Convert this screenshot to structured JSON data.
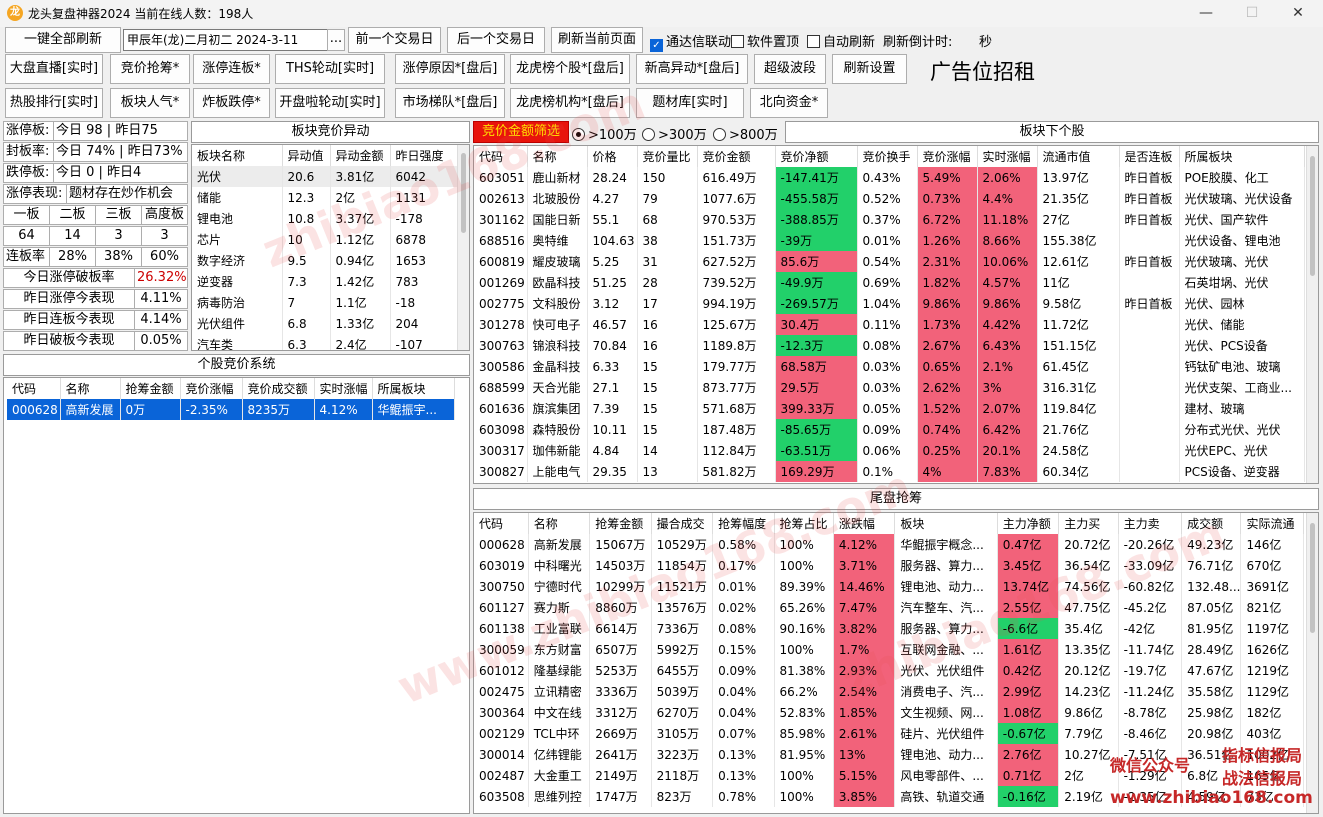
{
  "window": {
    "title": "龙头复盘神器2024 当前在线人数：198人",
    "logo": "龙",
    "min": "—",
    "max": "☐",
    "close": "✕"
  },
  "toolbar1": {
    "refresh_all": "一键全部刷新",
    "date": "甲辰年(龙)二月初二  2024-3-11",
    "date_btn": "...",
    "prev_day": "前一个交易日",
    "next_day": "后一个交易日",
    "refresh_page": "刷新当前页面",
    "tdx_link": "通达信联动",
    "on_top": "软件置顶",
    "auto_refresh": "自动刷新",
    "countdown_label": "刷新倒计时:",
    "countdown_unit": "秒"
  },
  "toolbar2": [
    "大盘直播[实时]",
    "竞价抢筹*",
    "涨停连板*",
    "THS轮动[实时]",
    "涨停原因*[盘后]",
    "龙虎榜个股*[盘后]",
    "新高异动*[盘后]",
    "超级波段",
    "刷新设置"
  ],
  "toolbar3": [
    "热股排行[实时]",
    "板块人气*",
    "炸板跌停*",
    "开盘啦轮动[实时]",
    "市场梯队*[盘后]",
    "龙虎榜机构*[盘后]",
    "题材库[实时]",
    "北向资金*"
  ],
  "ad_text": "广告位招租",
  "stats": {
    "limit_up_label": "涨停板:",
    "limit_up_val": "今日 98 | 昨日75",
    "seal_rate_label": "封板率:",
    "seal_rate_val": "今日 74% | 昨日73%",
    "limit_down_label": "跌停板:",
    "limit_down_val": "今日 0 | 昨日4",
    "perf_label": "涨停表现:",
    "perf_val": "题材存在炒作机会",
    "board_headers": [
      "一板",
      "二板",
      "三板",
      "高度板"
    ],
    "board_values": [
      "64",
      "14",
      "3",
      "3"
    ],
    "lianban_label": "连板率",
    "lianban_values": [
      "28%",
      "38%",
      "60%"
    ],
    "rows": [
      {
        "label": "今日涨停破板率",
        "value": "26.32%"
      },
      {
        "label": "昨日涨停今表现",
        "value": "4.11%"
      },
      {
        "label": "昨日连板今表现",
        "value": "4.14%"
      },
      {
        "label": "昨日破板今表现",
        "value": "0.05%"
      }
    ]
  },
  "sector_auction": {
    "title": "板块竞价异动",
    "headers": [
      "板块名称",
      "异动值",
      "异动金额",
      "昨日强度"
    ],
    "rows": [
      [
        "光伏",
        "20.6",
        "3.81亿",
        "6042"
      ],
      [
        "储能",
        "12.3",
        "2亿",
        "1131"
      ],
      [
        "锂电池",
        "10.8",
        "3.37亿",
        "-178"
      ],
      [
        "芯片",
        "10",
        "1.12亿",
        "6878"
      ],
      [
        "数字经济",
        "9.5",
        "0.94亿",
        "1653"
      ],
      [
        "逆变器",
        "7.3",
        "1.42亿",
        "783"
      ],
      [
        "病毒防治",
        "7",
        "1.1亿",
        "-18"
      ],
      [
        "光伏组件",
        "6.8",
        "1.33亿",
        "204"
      ],
      [
        "汽车类",
        "6.3",
        "2.4亿",
        "-107"
      ]
    ]
  },
  "stock_auction": {
    "title": "个股竞价系统",
    "headers": [
      "代码",
      "名称",
      "抢筹金额",
      "竞价涨幅",
      "竞价成交额",
      "实时涨幅",
      "所属板块"
    ],
    "rows": [
      [
        "000628",
        "高新发展",
        "0万",
        "-2.35%",
        "8235万",
        "4.12%",
        "华鲲振宇..."
      ]
    ]
  },
  "filter": {
    "label": "竞价金额筛选",
    "opt1": ">100万",
    "opt2": ">300万",
    "opt3": ">800万"
  },
  "sector_stocks": {
    "title": "板块下个股",
    "headers": [
      "代码",
      "名称",
      "价格",
      "竞价量比",
      "竞价金额",
      "竞价净额",
      "竞价换手",
      "竞价涨幅",
      "实时涨幅",
      "流通市值",
      "是否连板",
      "所属板块"
    ],
    "rows": [
      [
        "603051",
        "鹿山新材",
        "28.24",
        "150",
        "616.49万",
        "-147.41万",
        "0.43%",
        "5.49%",
        "2.06%",
        "13.97亿",
        "昨日首板",
        "POE胶膜、化工"
      ],
      [
        "002613",
        "北玻股份",
        "4.27",
        "79",
        "1077.6万",
        "-455.58万",
        "0.52%",
        "0.73%",
        "4.4%",
        "21.35亿",
        "昨日首板",
        "光伏玻璃、光伏设备"
      ],
      [
        "301162",
        "国能日新",
        "55.1",
        "68",
        "970.53万",
        "-388.85万",
        "0.37%",
        "6.72%",
        "11.18%",
        "27亿",
        "昨日首板",
        "光伏、国产软件"
      ],
      [
        "688516",
        "奥特维",
        "104.63",
        "38",
        "151.73万",
        "-39万",
        "0.01%",
        "1.26%",
        "8.66%",
        "155.38亿",
        "",
        "光伏设备、锂电池"
      ],
      [
        "600819",
        "耀皮玻璃",
        "5.25",
        "31",
        "627.52万",
        "85.6万",
        "0.54%",
        "2.31%",
        "10.06%",
        "12.61亿",
        "昨日首板",
        "光伏玻璃、光伏"
      ],
      [
        "001269",
        "欧晶科技",
        "51.25",
        "28",
        "739.52万",
        "-49.9万",
        "0.69%",
        "1.82%",
        "4.57%",
        "11亿",
        "",
        "石英坩埚、光伏"
      ],
      [
        "002775",
        "文科股份",
        "3.12",
        "17",
        "994.19万",
        "-269.57万",
        "1.04%",
        "9.86%",
        "9.86%",
        "9.58亿",
        "昨日首板",
        "光伏、园林"
      ],
      [
        "301278",
        "快可电子",
        "46.57",
        "16",
        "125.67万",
        "30.4万",
        "0.11%",
        "1.73%",
        "4.42%",
        "11.72亿",
        "",
        "光伏、储能"
      ],
      [
        "300763",
        "锦浪科技",
        "70.84",
        "16",
        "1189.8万",
        "-12.3万",
        "0.08%",
        "2.67%",
        "6.43%",
        "151.15亿",
        "",
        "光伏、PCS设备"
      ],
      [
        "300586",
        "金晶科技",
        "6.33",
        "15",
        "179.77万",
        "68.58万",
        "0.03%",
        "0.65%",
        "2.1%",
        "61.45亿",
        "",
        "钙钛矿电池、玻璃"
      ],
      [
        "688599",
        "天合光能",
        "27.1",
        "15",
        "873.77万",
        "29.5万",
        "0.03%",
        "2.62%",
        "3%",
        "316.31亿",
        "",
        "光伏支架、工商业..."
      ],
      [
        "601636",
        "旗滨集团",
        "7.39",
        "15",
        "571.68万",
        "399.33万",
        "0.05%",
        "1.52%",
        "2.07%",
        "119.84亿",
        "",
        "建材、玻璃"
      ],
      [
        "603098",
        "森特股份",
        "10.11",
        "15",
        "187.48万",
        "-85.65万",
        "0.09%",
        "0.74%",
        "6.42%",
        "21.76亿",
        "",
        "分布式光伏、光伏"
      ],
      [
        "300317",
        "珈伟新能",
        "4.84",
        "14",
        "112.84万",
        "-63.51万",
        "0.06%",
        "0.25%",
        "20.1%",
        "24.58亿",
        "",
        "光伏EPC、光伏"
      ],
      [
        "300827",
        "上能电气",
        "29.35",
        "13",
        "581.82万",
        "169.29万",
        "0.1%",
        "4%",
        "7.83%",
        "60.34亿",
        "",
        "PCS设备、逆变器"
      ]
    ]
  },
  "tail": {
    "title": "尾盘抢筹",
    "headers": [
      "代码",
      "名称",
      "抢筹金额",
      "撮合成交",
      "抢筹幅度",
      "抢筹占比",
      "涨跌幅",
      "板块",
      "主力净额",
      "主力买",
      "主力卖",
      "成交额",
      "实际流通"
    ],
    "rows": [
      [
        "000628",
        "高新发展",
        "15067万",
        "10529万",
        "0.58%",
        "100%",
        "4.12%",
        "华鲲振宇概念...",
        "0.47亿",
        "20.72亿",
        "-20.26亿",
        "49.23亿",
        "146亿"
      ],
      [
        "603019",
        "中科曙光",
        "14503万",
        "11854万",
        "0.17%",
        "100%",
        "3.71%",
        "服务器、算力...",
        "3.45亿",
        "36.54亿",
        "-33.09亿",
        "76.71亿",
        "670亿"
      ],
      [
        "300750",
        "宁德时代",
        "10299万",
        "11521万",
        "0.01%",
        "89.39%",
        "14.46%",
        "锂电池、动力...",
        "13.74亿",
        "74.56亿",
        "-60.82亿",
        "132.48...",
        "3691亿"
      ],
      [
        "601127",
        "赛力斯",
        "8860万",
        "13576万",
        "0.02%",
        "65.26%",
        "7.47%",
        "汽车整车、汽...",
        "2.55亿",
        "47.75亿",
        "-45.2亿",
        "87.05亿",
        "821亿"
      ],
      [
        "601138",
        "工业富联",
        "6614万",
        "7336万",
        "0.08%",
        "90.16%",
        "3.82%",
        "服务器、算力...",
        "-6.6亿",
        "35.4亿",
        "-42亿",
        "81.95亿",
        "1197亿"
      ],
      [
        "300059",
        "东方财富",
        "6507万",
        "5992万",
        "0.15%",
        "100%",
        "1.7%",
        "互联网金融、...",
        "1.61亿",
        "13.35亿",
        "-11.74亿",
        "28.49亿",
        "1626亿"
      ],
      [
        "601012",
        "隆基绿能",
        "5253万",
        "6455万",
        "0.09%",
        "81.38%",
        "2.93%",
        "光伏、光伏组件",
        "0.42亿",
        "20.12亿",
        "-19.7亿",
        "47.67亿",
        "1219亿"
      ],
      [
        "002475",
        "立讯精密",
        "3336万",
        "5039万",
        "0.04%",
        "66.2%",
        "2.54%",
        "消费电子、汽...",
        "2.99亿",
        "14.23亿",
        "-11.24亿",
        "35.58亿",
        "1129亿"
      ],
      [
        "300364",
        "中文在线",
        "3312万",
        "6270万",
        "0.04%",
        "52.83%",
        "1.85%",
        "文生视频、网...",
        "1.08亿",
        "9.86亿",
        "-8.78亿",
        "25.98亿",
        "182亿"
      ],
      [
        "002129",
        "TCL中环",
        "2669万",
        "3105万",
        "0.07%",
        "85.98%",
        "2.61%",
        "硅片、光伏组件",
        "-0.67亿",
        "7.79亿",
        "-8.46亿",
        "20.98亿",
        "403亿"
      ],
      [
        "300014",
        "亿纬锂能",
        "2641万",
        "3223万",
        "0.13%",
        "81.95%",
        "13%",
        "锂电池、动力...",
        "2.76亿",
        "10.27亿",
        "-7.51亿",
        "36.51亿",
        "1002亿"
      ],
      [
        "002487",
        "大金重工",
        "2149万",
        "2118万",
        "0.13%",
        "100%",
        "5.15%",
        "风电零部件、...",
        "0.71亿",
        "2亿",
        "-1.29亿",
        "6.8亿",
        "165亿"
      ],
      [
        "603508",
        "思维列控",
        "1747万",
        "823万",
        "0.78%",
        "100%",
        "3.85%",
        "高铁、轨道交通",
        "-0.16亿",
        "2.19亿",
        "-2.35亿",
        "4.59亿",
        "73亿"
      ]
    ]
  },
  "watermarks": [
    "zhibiao168.com",
    "www.zhibiao168.com",
    "zhibiao168.com"
  ],
  "brand": {
    "wechat": "微信公众号",
    "name1": "指标信报局",
    "name2": "战法信报局",
    "site": "www.zhibiao168.com"
  }
}
